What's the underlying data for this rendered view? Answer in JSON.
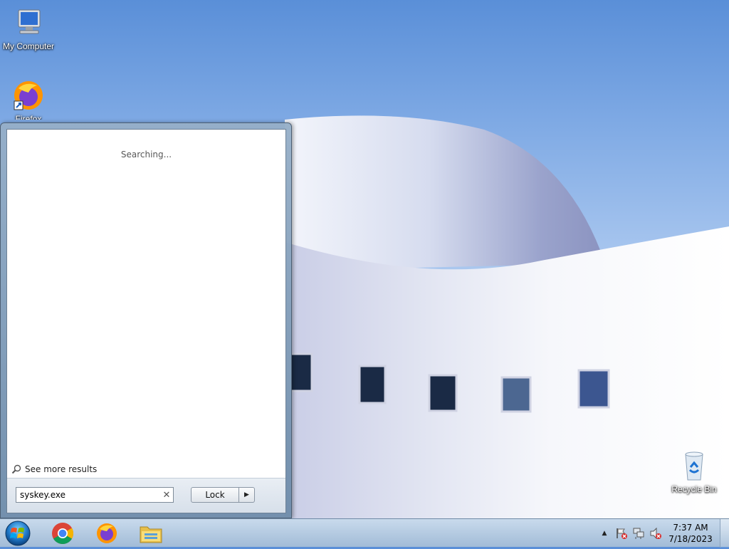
{
  "desktop": {
    "icons": [
      {
        "label": "My Computer",
        "icon": "computer-icon"
      },
      {
        "label": "Firefox",
        "icon": "firefox-icon"
      },
      {
        "label": "Recycle Bin",
        "icon": "recycle-bin-icon"
      }
    ]
  },
  "start_menu": {
    "status_text": "Searching...",
    "see_more_label": "See more results",
    "search": {
      "value": "syskey.exe"
    },
    "lock_label": "Lock"
  },
  "taskbar": {
    "apps": [
      {
        "name": "Google Chrome",
        "icon": "chrome-icon"
      },
      {
        "name": "Firefox",
        "icon": "firefox-icon"
      },
      {
        "name": "File Explorer",
        "icon": "folder-icon"
      }
    ],
    "clock": {
      "time": "7:37 AM",
      "date": "7/18/2023"
    }
  },
  "colors": {
    "accent": "#1f5fa8",
    "taskbar": "#b4c9e0"
  }
}
